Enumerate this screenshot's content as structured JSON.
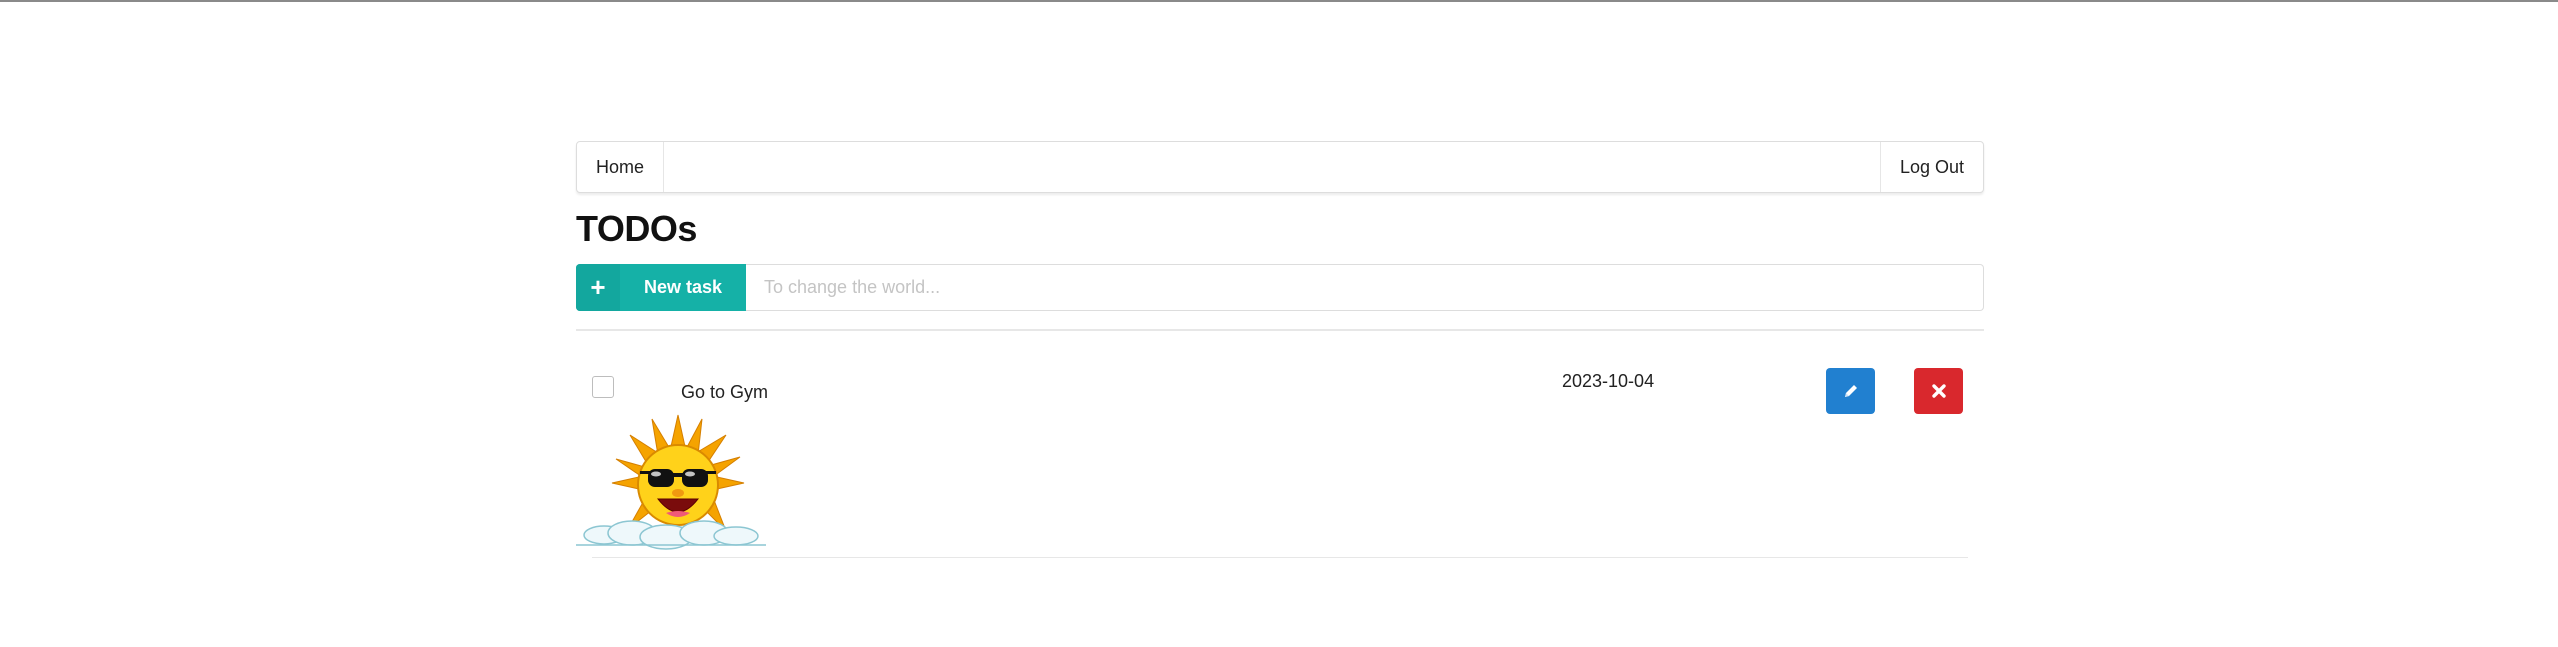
{
  "nav": {
    "home_label": "Home",
    "logout_label": "Log Out"
  },
  "page": {
    "title": "TODOs"
  },
  "new_task": {
    "plus_icon": "+",
    "button_label": "New task",
    "placeholder": "To change the world..."
  },
  "tasks": [
    {
      "name": "Go to Gym",
      "date": "2023-10-04",
      "completed": false,
      "image": "sun-with-sunglasses-on-cloud",
      "edit_icon": "pencil-icon",
      "delete_icon": "x-icon"
    }
  ],
  "colors": {
    "accent_teal": "#15b1a7",
    "edit_blue": "#2180d0",
    "delete_red": "#d9282d"
  }
}
